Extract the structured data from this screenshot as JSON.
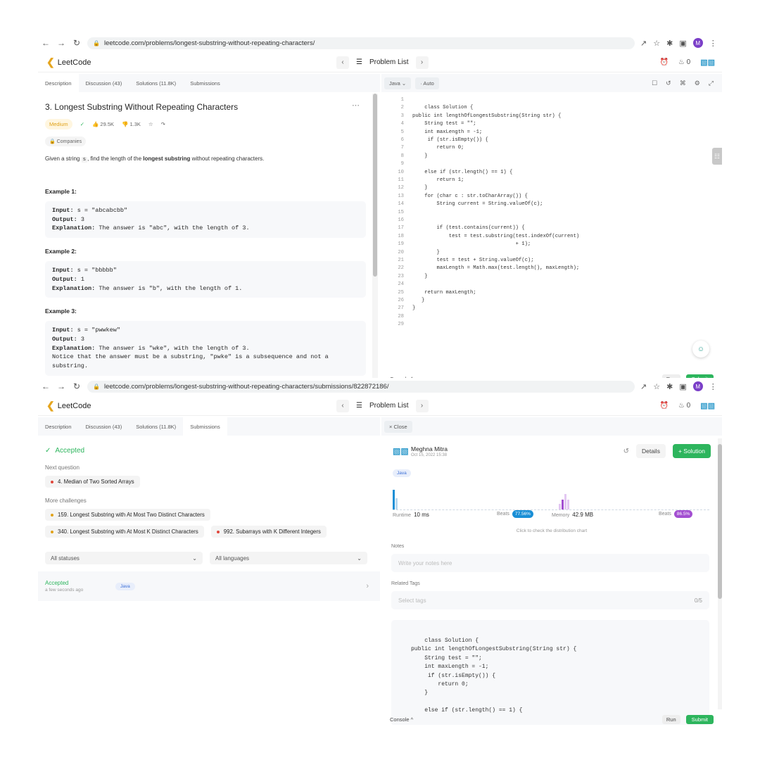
{
  "browser1": {
    "url": "leetcode.com/problems/longest-substring-without-repeating-characters/",
    "avatar": "M"
  },
  "browser2": {
    "url": "leetcode.com/problems/longest-substring-without-repeating-characters/submissions/822872186/",
    "avatar": "M"
  },
  "header": {
    "logo_text": "LeetCode",
    "problem_list": "Problem List",
    "streak": "0"
  },
  "tabs": {
    "description": "Description",
    "discussion": "Discussion (43)",
    "solutions": "Solutions (11.8K)",
    "submissions": "Submissions"
  },
  "editor": {
    "language": "Java",
    "mode": "Auto",
    "close": "Close"
  },
  "problem": {
    "title": "3. Longest Substring Without Repeating Characters",
    "difficulty": "Medium",
    "likes": "29.5K",
    "dislikes": "1.3K",
    "companies": "Companies",
    "text_before": "Given a string ",
    "text_var": "s",
    "text_mid": ", find the length of the ",
    "text_bold": "longest substring",
    "text_after": " without repeating characters.",
    "examples": [
      {
        "heading": "Example 1:",
        "input": "s = \"abcabcbb\"",
        "output": "3",
        "explanation": "The answer is \"abc\", with the length of 3.",
        "extra": ""
      },
      {
        "heading": "Example 2:",
        "input": "s = \"bbbbb\"",
        "output": "1",
        "explanation": "The answer is \"b\", with the length of 1.",
        "extra": ""
      },
      {
        "heading": "Example 3:",
        "input": "s = \"pwwkew\"",
        "output": "3",
        "explanation": "The answer is \"wke\", with the length of 3.",
        "extra": "Notice that the answer must be a substring, \"pwke\" is a subsequence and not a\nsubstring."
      }
    ],
    "labels": {
      "input": "Input:",
      "output": "Output:",
      "explanation": "Explanation:"
    }
  },
  "code": {
    "line_numbers": [
      "1",
      "2",
      "3",
      "4",
      "5",
      "6",
      "7",
      "8",
      "9",
      "10",
      "11",
      "12",
      "13",
      "14",
      "15",
      "16",
      "17",
      "18",
      "19",
      "20",
      "21",
      "22",
      "23",
      "24",
      "25",
      "26",
      "27",
      "28",
      "29"
    ],
    "lines": [
      "",
      "    class Solution {",
      "public int lengthOfLongestSubstring(String str) {",
      "    String test = \"\";",
      "    int maxLength = -1;",
      "     if (str.isEmpty()) {",
      "        return 0;",
      "    }",
      "",
      "    else if (str.length() == 1) {",
      "        return 1;",
      "    }",
      "    for (char c : str.toCharArray()) {",
      "        String current = String.valueOf(c);",
      "",
      "",
      "        if (test.contains(current)) {",
      "            test = test.substring(test.indexOf(current)",
      "                                  + 1);",
      "        }",
      "        test = test + String.valueOf(c);",
      "        maxLength = Math.max(test.length(), maxLength);",
      "    }",
      "",
      "    return maxLength;",
      "   }",
      "}",
      "",
      ""
    ]
  },
  "console": {
    "label": "Console ^",
    "run": "Run",
    "submit": "Submit"
  },
  "submission": {
    "status": "Accepted",
    "next_question_label": "Next question",
    "next_question": "4. Median of Two Sorted Arrays",
    "more_challenges_label": "More challenges",
    "challenges": [
      "159. Longest Substring with At Most Two Distinct Characters",
      "340. Longest Substring with At Most K Distinct Characters",
      "992. Subarrays with K Different Integers"
    ],
    "filter_status": "All statuses",
    "filter_language": "All languages",
    "row_status": "Accepted",
    "row_time": "a few seconds ago",
    "row_lang": "Java"
  },
  "detail": {
    "user": "Meghna Mitra",
    "date": "Oct 15, 2022 15:38",
    "details_btn": "Details",
    "solution_btn": "+ Solution",
    "lang": "Java",
    "runtime_label": "Runtime",
    "runtime": "10 ms",
    "beats_label": "Beats",
    "runtime_beats": "77.56%",
    "memory_label": "Memory",
    "memory": "42.9 MB",
    "memory_beats": "86.5%",
    "chart_hint": "Click to check the distribution chart",
    "notes_label": "Notes",
    "notes_placeholder": "Write your notes here",
    "tags_label": "Related Tags",
    "tags_placeholder": "Select tags",
    "tags_count": "0/5",
    "code_preview": "    class Solution {\npublic int lengthOfLongestSubstring(String str) {\n    String test = \"\";\n    int maxLength = -1;\n     if (str.isEmpty()) {\n        return 0;\n    }\n\n    else if (str.length() == 1) {"
  },
  "colors": {
    "accent_green": "#2db55d",
    "medium": "#e0a21a",
    "runtime_badge": "#1a8fd6",
    "memory_badge": "#a34fd1"
  }
}
